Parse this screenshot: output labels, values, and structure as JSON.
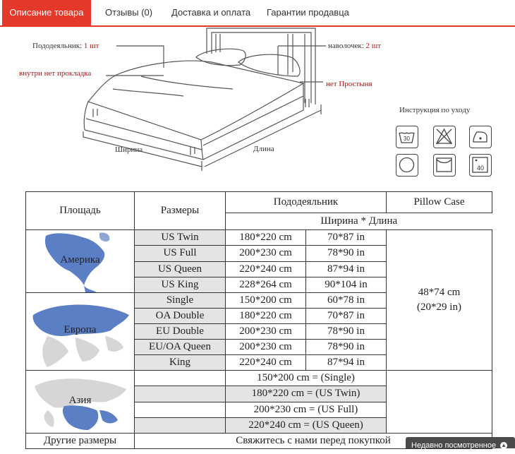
{
  "tabs": [
    {
      "label": "Описание товара",
      "active": true
    },
    {
      "label": "Отзывы (0)"
    },
    {
      "label": "Доставка и оплата"
    },
    {
      "label": "Гарантии продавца"
    }
  ],
  "illustration": {
    "duvet_label": "Пододеяльник: ",
    "duvet_count": "1 шт",
    "no_filling": "внутри нет прокладка",
    "pillowcase_label": "наволочек: ",
    "pillowcase_count": "2 шт",
    "no_sheet": "нет Простыня",
    "width_label": "Ширина",
    "length_label": "Длина",
    "care_title": "Инструкция по уходу",
    "care_icons": [
      "wash-30-icon",
      "no-tumble-dry-icon",
      "iron-icon",
      "dry-clean-icon",
      "line-dry-icon",
      "wash-40-icon"
    ],
    "wash30": "30",
    "wash40": "40"
  },
  "table": {
    "h_area": "Площадь",
    "h_sizes": "Размеры",
    "h_duvet": "Пододеяльник",
    "h_pillow": "Pillow Case",
    "h_dims": "Ширина * Длина",
    "america": {
      "label": "Америка",
      "rows": [
        {
          "size": "US Twin",
          "cm": "180*220 cm",
          "in": "70*87 in"
        },
        {
          "size": "US Full",
          "cm": "200*230 cm",
          "in": "78*90 in"
        },
        {
          "size": "US Queen",
          "cm": "220*240 cm",
          "in": "87*94 in"
        },
        {
          "size": "US King",
          "cm": "228*264 cm",
          "in": "90*104 in"
        }
      ]
    },
    "europe": {
      "label": "Европа",
      "rows": [
        {
          "size": "Single",
          "cm": "150*200 cm",
          "in": "60*78 in"
        },
        {
          "size": "OA Double",
          "cm": "180*220 cm",
          "in": "70*87 in"
        },
        {
          "size": "EU Double",
          "cm": "200*230 cm",
          "in": "78*90 in"
        },
        {
          "size": "EU/OA Queen",
          "cm": "200*230 cm",
          "in": "78*90 in"
        },
        {
          "size": "King",
          "cm": "220*240 cm",
          "in": "87*94 in"
        }
      ]
    },
    "pillow_cm": "48*74 cm",
    "pillow_in": "(20*29 in)",
    "asia": {
      "label": "Азия",
      "rows": [
        "150*200 cm = (Single)",
        "180*220 cm = (US Twin)",
        "200*230 cm = (US Full)",
        "220*240 cm = (US Queen)"
      ]
    },
    "other_sizes": "Другие размеры",
    "contact": "Свяжитесь с нами перед покупкой"
  },
  "recently_viewed": "Недавно посмотренное",
  "colors": {
    "accent": "#e4382a",
    "label_red": "#b01818",
    "map_blue": "#5b7fc4"
  }
}
